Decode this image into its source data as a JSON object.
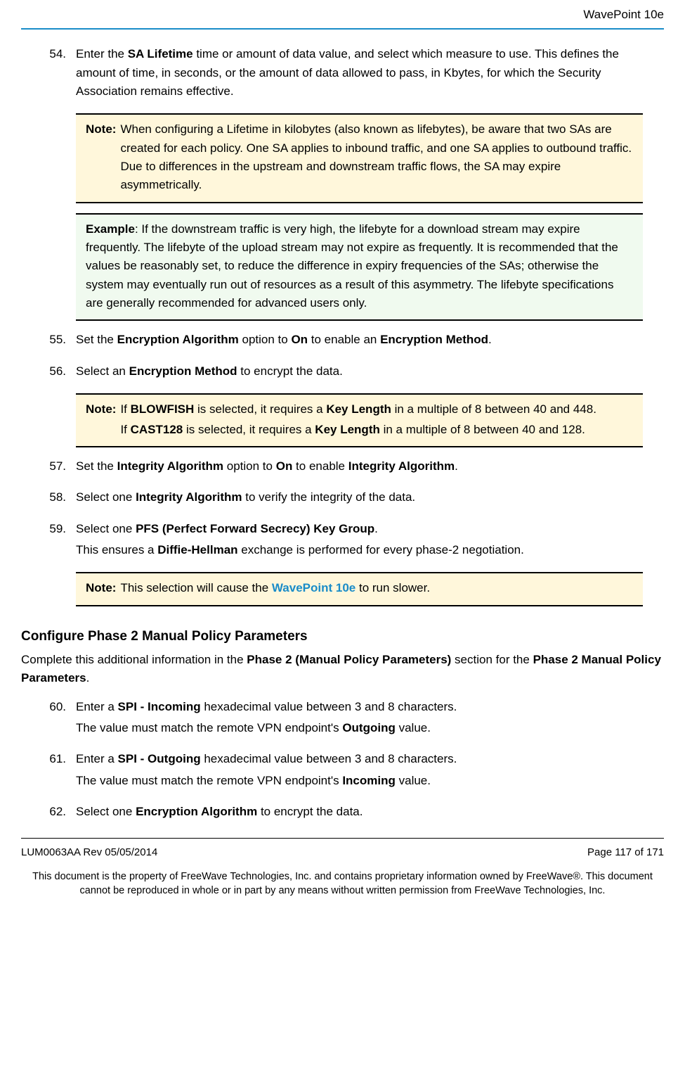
{
  "header": {
    "title": "WavePoint 10e"
  },
  "items": [
    {
      "num": "54.",
      "paragraphs": [
        [
          {
            "t": "Enter the "
          },
          {
            "t": "SA Lifetime",
            "b": true
          },
          {
            "t": " time or amount of data value, and select which measure to use. This defines the amount of time, in seconds, or the amount of data allowed to pass, in Kbytes, for which the Security Association remains effective."
          }
        ]
      ],
      "callouts": [
        {
          "type": "note",
          "label": "Note:",
          "body": [
            [
              {
                "t": "When configuring a Lifetime in kilobytes (also known as lifebytes), be aware that two SAs are created for each policy. One SA applies to inbound traffic, and one SA applies to outbound traffic. Due to differences in the upstream and downstream traffic flows, the SA may expire asymmetrically."
              }
            ]
          ]
        },
        {
          "type": "example",
          "label": "Example",
          "body": [
            [
              {
                "t": ": If the downstream traffic is very high, the lifebyte for a download stream may expire frequently. The lifebyte of the upload stream may not expire as frequently. It is recommended that the values be reasonably set, to reduce the difference in expiry frequencies of the SAs; otherwise the system may eventually run out of resources as a result of this asymmetry. The lifebyte specifications are generally recommended for advanced users only."
              }
            ]
          ],
          "inline_label": true
        }
      ]
    },
    {
      "num": "55.",
      "paragraphs": [
        [
          {
            "t": "Set the "
          },
          {
            "t": "Encryption Algorithm",
            "b": true
          },
          {
            "t": " option to "
          },
          {
            "t": "On",
            "b": true
          },
          {
            "t": " to enable an "
          },
          {
            "t": "Encryption Method",
            "b": true
          },
          {
            "t": "."
          }
        ]
      ]
    },
    {
      "num": "56.",
      "paragraphs": [
        [
          {
            "t": "Select an "
          },
          {
            "t": "Encryption Method",
            "b": true
          },
          {
            "t": " to encrypt the data."
          }
        ]
      ],
      "callouts": [
        {
          "type": "note",
          "label": "Note:",
          "body": [
            [
              {
                "t": "If "
              },
              {
                "t": "BLOWFISH",
                "b": true
              },
              {
                "t": " is selected, it requires a "
              },
              {
                "t": "Key Length",
                "b": true
              },
              {
                "t": " in a multiple of 8 between 40 and 448."
              }
            ],
            [
              {
                "t": "If "
              },
              {
                "t": "CAST128",
                "b": true
              },
              {
                "t": " is selected, it requires a "
              },
              {
                "t": "Key Length",
                "b": true
              },
              {
                "t": " in a multiple of 8 between 40 and 128."
              }
            ]
          ]
        }
      ]
    },
    {
      "num": "57.",
      "paragraphs": [
        [
          {
            "t": "Set the "
          },
          {
            "t": "Integrity Algorithm",
            "b": true
          },
          {
            "t": " option to "
          },
          {
            "t": "On",
            "b": true
          },
          {
            "t": " to enable "
          },
          {
            "t": "Integrity Algorithm",
            "b": true
          },
          {
            "t": "."
          }
        ]
      ]
    },
    {
      "num": "58.",
      "paragraphs": [
        [
          {
            "t": "Select one "
          },
          {
            "t": "Integrity Algorithm",
            "b": true
          },
          {
            "t": " to verify the integrity of the data."
          }
        ]
      ]
    },
    {
      "num": "59.",
      "paragraphs": [
        [
          {
            "t": "Select one "
          },
          {
            "t": "PFS (Perfect Forward Secrecy) Key Group",
            "b": true
          },
          {
            "t": "."
          }
        ],
        [
          {
            "t": "This ensures a "
          },
          {
            "t": "Diffie-Hellman",
            "b": true
          },
          {
            "t": " exchange is performed for every phase-2 negotiation."
          }
        ]
      ],
      "callouts": [
        {
          "type": "note",
          "label": "Note:",
          "body": [
            [
              {
                "t": "This selection will cause the "
              },
              {
                "t": "WavePoint 10e",
                "link": true
              },
              {
                "t": " to run slower."
              }
            ]
          ]
        }
      ]
    }
  ],
  "section2": {
    "heading": "Configure Phase 2 Manual Policy Parameters",
    "intro": [
      {
        "t": "Complete this additional information in the "
      },
      {
        "t": "Phase 2 (Manual Policy Parameters)",
        "b": true
      },
      {
        "t": " section for the "
      },
      {
        "t": "Phase 2 Manual Policy Parameters",
        "b": true
      },
      {
        "t": "."
      }
    ],
    "items": [
      {
        "num": "60.",
        "paragraphs": [
          [
            {
              "t": "Enter a "
            },
            {
              "t": "SPI - Incoming",
              "b": true
            },
            {
              "t": " hexadecimal value between 3 and 8 characters."
            }
          ],
          [
            {
              "t": "The value must match the remote VPN endpoint's "
            },
            {
              "t": "Outgoing",
              "b": true
            },
            {
              "t": " value."
            }
          ]
        ]
      },
      {
        "num": "61.",
        "paragraphs": [
          [
            {
              "t": "Enter a "
            },
            {
              "t": "SPI - Outgoing",
              "b": true
            },
            {
              "t": " hexadecimal value between 3 and 8 characters."
            }
          ],
          [
            {
              "t": "The value must match the remote VPN endpoint's "
            },
            {
              "t": "Incoming",
              "b": true
            },
            {
              "t": " value."
            }
          ]
        ]
      },
      {
        "num": "62.",
        "paragraphs": [
          [
            {
              "t": "Select one "
            },
            {
              "t": "Encryption Algorithm",
              "b": true
            },
            {
              "t": " to encrypt the data."
            }
          ]
        ]
      }
    ]
  },
  "footer": {
    "left": "LUM0063AA Rev 05/05/2014",
    "right": "Page 117 of 171",
    "notice": "This document is the property of FreeWave Technologies, Inc. and contains proprietary information owned by FreeWave®. This document cannot be reproduced in whole or in part by any means without written permission from FreeWave Technologies, Inc."
  }
}
